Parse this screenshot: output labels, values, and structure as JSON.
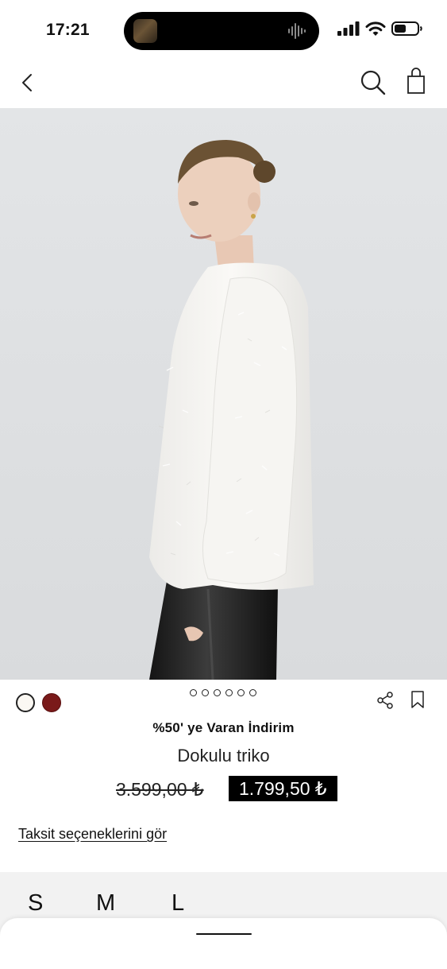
{
  "status_bar": {
    "time": "17:21"
  },
  "nav": {
    "back_icon": "chevron-left-icon",
    "search_icon": "search-icon",
    "bag_icon": "shopping-bag-icon"
  },
  "product": {
    "color_swatches": [
      {
        "name": "white",
        "color": "#fbf8f3",
        "selected": true
      },
      {
        "name": "burgundy",
        "color": "#7a1a1a",
        "selected": false
      }
    ],
    "image_pages": 6,
    "promo": "%50' ye Varan İndirim",
    "name": "Dokulu triko",
    "old_price": "3.599,00 ₺",
    "new_price": "1.799,50 ₺",
    "installment_link": "Taksit seçeneklerini gör"
  },
  "sizes": [
    "S",
    "M",
    "L"
  ],
  "colors": {
    "sale_badge_bg": "#000000",
    "size_panel_bg": "#f2f2f2"
  }
}
